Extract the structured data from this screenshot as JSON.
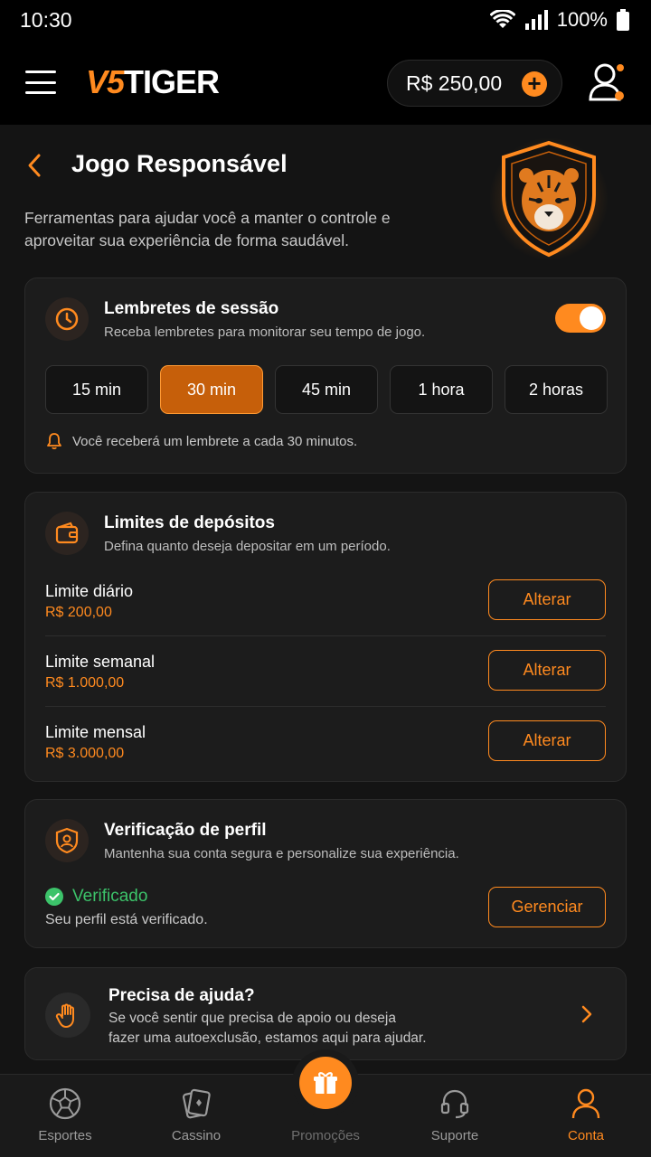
{
  "status_bar": {
    "time": "10:30",
    "battery": "100%"
  },
  "header": {
    "logo_prefix": "V5",
    "logo_suffix": "TIGER",
    "balance": "R$ 250,00"
  },
  "page": {
    "title": "Jogo Responsável",
    "subtitle": "Ferramentas para ajudar você a manter o controle e aproveitar sua experiência de forma saudável."
  },
  "session_reminders": {
    "title": "Lembretes de sessão",
    "description": "Receba lembretes para monitorar seu tempo de jogo.",
    "enabled": true,
    "options": [
      "15 min",
      "30 min",
      "45 min",
      "1 hora",
      "2 horas"
    ],
    "selected": "30 min",
    "note": "Você receberá um lembrete a cada 30 minutos."
  },
  "deposit_limits": {
    "title": "Limites de depósitos",
    "description": "Defina quanto deseja depositar em um período.",
    "rows": [
      {
        "label": "Limite diário",
        "value": "R$ 200,00",
        "action": "Alterar"
      },
      {
        "label": "Limite semanal",
        "value": "R$ 1.000,00",
        "action": "Alterar"
      },
      {
        "label": "Limite mensal",
        "value": "R$ 3.000,00",
        "action": "Alterar"
      }
    ]
  },
  "profile_verification": {
    "title": "Verificação de perfil",
    "description": "Mantenha sua conta segura e personalize sua experiência.",
    "status": "Verificado",
    "status_desc": "Seu perfil está verificado.",
    "action": "Gerenciar"
  },
  "help": {
    "title": "Precisa de ajuda?",
    "line1": "Se você sentir que precisa de apoio ou deseja",
    "line2": "fazer uma autoexclusão, estamos aqui para ajudar."
  },
  "bottom_nav": {
    "items": [
      {
        "label": "Esportes",
        "icon": "soccer-ball-icon"
      },
      {
        "label": "Cassino",
        "icon": "cards-icon"
      },
      {
        "label": "Promoções",
        "icon": "gift-icon"
      },
      {
        "label": "Suporte",
        "icon": "headset-icon"
      },
      {
        "label": "Conta",
        "icon": "user-icon"
      }
    ],
    "active": "Conta"
  },
  "colors": {
    "accent": "#ff8a1f",
    "success": "#3cc36a",
    "background": "#141414",
    "card": "#1c1c1c"
  }
}
